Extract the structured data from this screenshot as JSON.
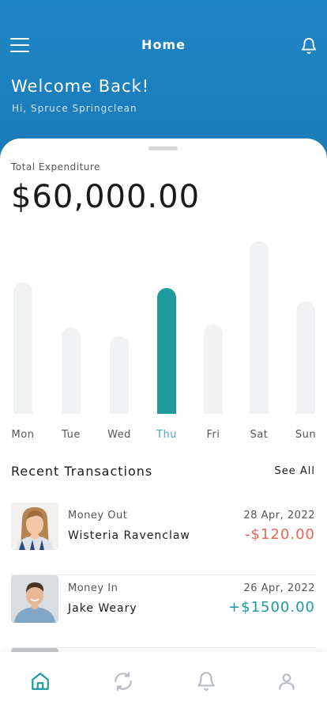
{
  "header": {
    "title": "Home",
    "welcome": "Welcome Back!",
    "greeting": "Hi, Spruce Springclean",
    "icons": {
      "menu": "hamburger-icon",
      "notifications": "bell-icon"
    }
  },
  "summary": {
    "label": "Total Expenditure",
    "amount": "$60,000.00"
  },
  "chart_data": {
    "type": "bar",
    "categories": [
      "Mon",
      "Tue",
      "Wed",
      "Thu",
      "Fri",
      "Sat",
      "Sun"
    ],
    "values": [
      0.76,
      0.5,
      0.45,
      0.73,
      0.52,
      1.0,
      0.65
    ],
    "highlighted": "Thu",
    "colors": {
      "default": "#f1f2f4",
      "highlight": "#1f9a9d"
    }
  },
  "recent": {
    "title": "Recent Transactions",
    "see_all": "See All",
    "transactions": [
      {
        "kind": "Money Out",
        "name": "Wisteria Ravenclaw",
        "date": "28 Apr, 2022",
        "amount": "-$120.00",
        "color": "#e8675a"
      },
      {
        "kind": "Money In",
        "name": "Jake Weary",
        "date": "26 Apr, 2022",
        "amount": "+$1500.00",
        "color": "#1f9a9d"
      }
    ]
  },
  "tabbar": {
    "items": [
      "home-icon",
      "refresh-icon",
      "bell-icon",
      "user-icon"
    ],
    "active": "home-icon",
    "colors": {
      "active": "#1f9a9d",
      "inactive": "#b8bcc8"
    }
  }
}
